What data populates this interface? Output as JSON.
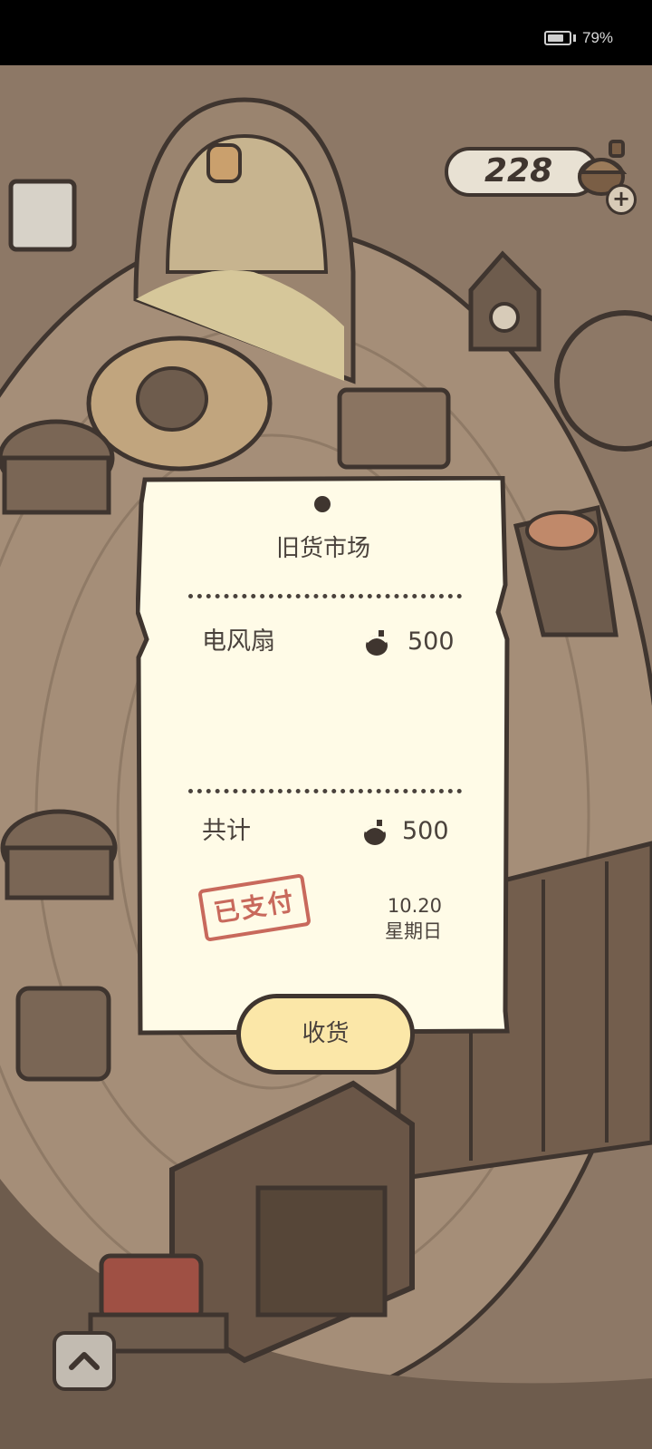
{
  "status_bar": {
    "battery_level": 0.79,
    "battery_text": "79%"
  },
  "hud": {
    "coin_count": "228",
    "plus_label": "+"
  },
  "receipt": {
    "title": "旧货市场",
    "item": {
      "name": "电风扇",
      "price": "500"
    },
    "total": {
      "label": "共计",
      "price": "500"
    },
    "stamp": "已支付",
    "date": "10.20",
    "weekday": "星期日"
  },
  "receive_button": {
    "label": "收货"
  },
  "colors": {
    "outline": "#3f352f",
    "paper": "#fffbe7",
    "stamp": "#c8695c",
    "button": "#fbe7a8"
  },
  "icons": [
    "battery-icon",
    "acorn-coin-icon",
    "plus-icon",
    "chevron-up-icon"
  ]
}
